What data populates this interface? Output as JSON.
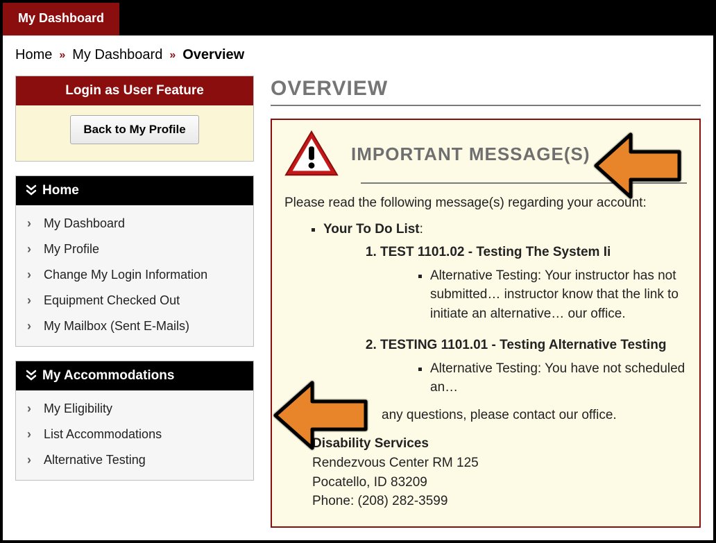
{
  "topbar": {
    "tab": "My Dashboard"
  },
  "breadcrumb": {
    "items": [
      "Home",
      "My Dashboard"
    ],
    "current": "Overview"
  },
  "sidebar": {
    "login_box": {
      "title": "Login as User Feature",
      "button": "Back to My Profile"
    },
    "groups": [
      {
        "title": "Home",
        "items": [
          "My Dashboard",
          "My Profile",
          "Change My Login Information",
          "Equipment Checked Out",
          "My Mailbox (Sent E-Mails)"
        ]
      },
      {
        "title": "My Accommodations",
        "items": [
          "My Eligibility",
          "List Accommodations",
          "Alternative Testing"
        ]
      }
    ]
  },
  "main": {
    "title": "OVERVIEW",
    "important": {
      "heading": "IMPORTANT MESSAGE(S)",
      "intro": "Please read the following message(s) regarding your account:",
      "todo_label": "Your To Do List",
      "todo": [
        {
          "title": "TEST 1101.02 - Testing The System Ii",
          "detail": "Alternative Testing: Your instructor has not submitted… instructor know that the link to initiate an alternative… our office."
        },
        {
          "title": "TESTING 1101.01 - Testing Alternative Testing",
          "detail": "Alternative Testing: You have not scheduled an…"
        }
      ],
      "questions_line": "any questions, please contact our office.",
      "contact": {
        "name": "Disability Services",
        "addr1": "Rendezvous Center RM 125",
        "addr2": "Pocatello, ID 83209",
        "phone": "Phone: (208) 282-3599"
      }
    }
  },
  "colors": {
    "brand_red": "#8b0e0e",
    "accent_orange": "#e8842a"
  }
}
